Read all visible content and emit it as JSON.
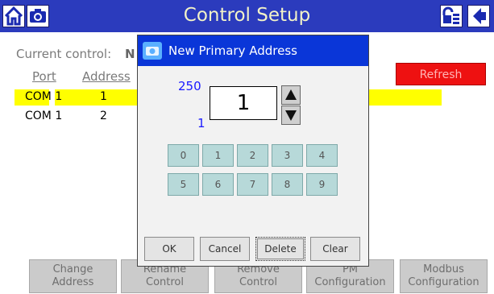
{
  "header": {
    "title": "Control Setup",
    "left_icons": [
      "home-icon",
      "camera-icon"
    ],
    "right_icons": [
      "login-icon",
      "back-icon"
    ]
  },
  "main": {
    "current_control_label": "Current control:",
    "current_control_value": "N",
    "columns": [
      "Port",
      "Address"
    ],
    "rows": [
      {
        "port": "COM 1",
        "address": "1"
      },
      {
        "port": "COM 1",
        "address": "2"
      }
    ],
    "refresh_label": "Refresh"
  },
  "bottom_buttons": [
    {
      "line1": "Change",
      "line2": "Address"
    },
    {
      "line1": "Rename",
      "line2": "Control"
    },
    {
      "line1": "Remove",
      "line2": "Control"
    },
    {
      "line1": "PM",
      "line2": "Configuration"
    },
    {
      "line1": "Modbus",
      "line2": "Configuration"
    }
  ],
  "dialog": {
    "title": "New Primary Address",
    "max_value": "250",
    "min_value": "1",
    "current_value": "1",
    "keypad": [
      "0",
      "1",
      "2",
      "3",
      "4",
      "5",
      "6",
      "7",
      "8",
      "9"
    ],
    "buttons": {
      "ok": "OK",
      "cancel": "Cancel",
      "delete": "Delete",
      "clear": "Clear"
    }
  },
  "colors": {
    "header_bg": "#2b3bbd",
    "dialog_title_bg": "#0a36d8",
    "highlight_row": "#ffff00",
    "refresh_bg": "#ee1111",
    "keypad_bg": "#b7d9d9"
  }
}
